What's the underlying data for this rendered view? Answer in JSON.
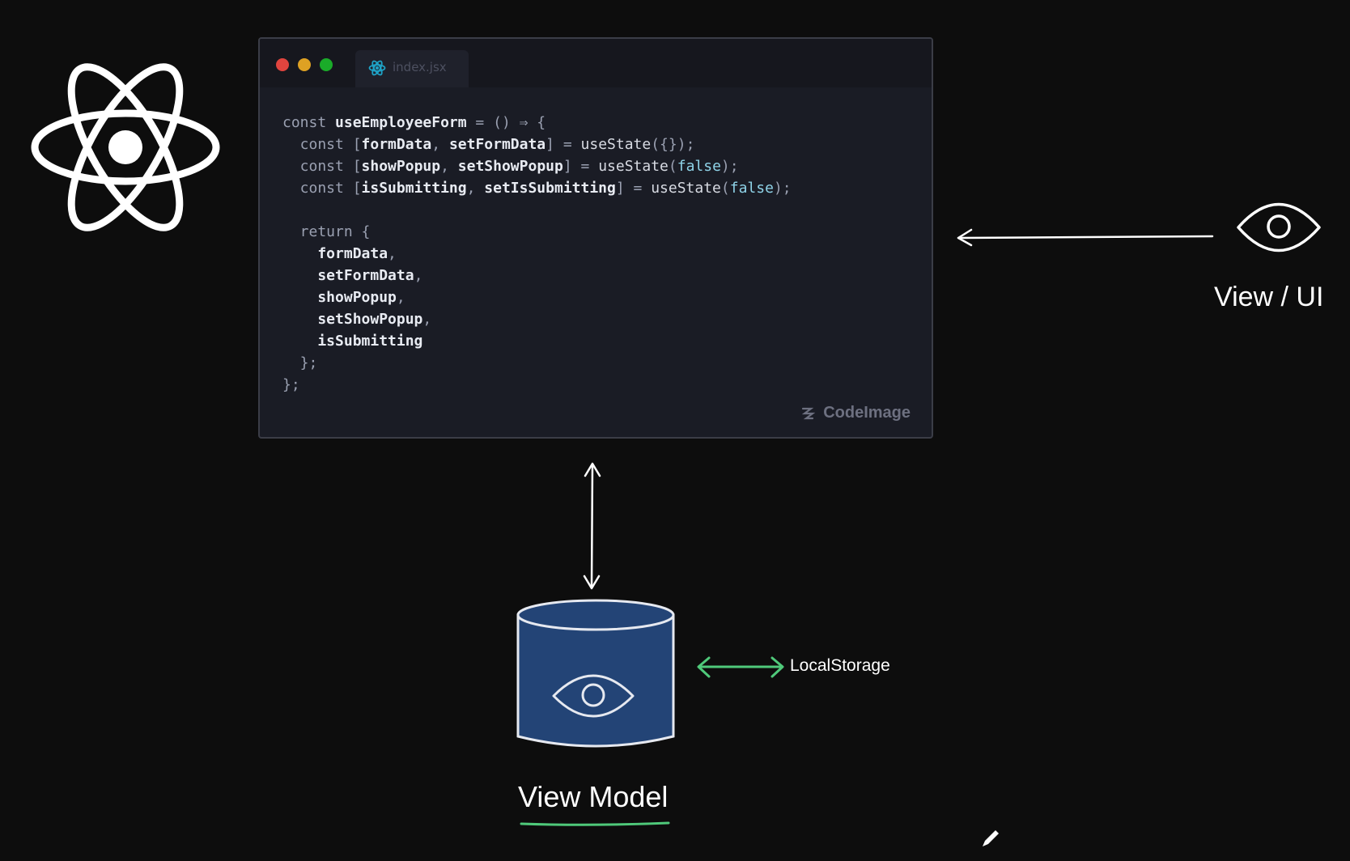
{
  "code_window": {
    "tab_label": "index.jsx",
    "watermark": "CodeImage",
    "dots": {
      "red": "#e0443e",
      "yellow": "#dea123",
      "green": "#1aab29"
    },
    "lines": [
      [
        [
          "kw",
          "const "
        ],
        [
          "id",
          "useEmployeeForm"
        ],
        [
          "pun",
          " = () ⇒ {"
        ]
      ],
      [
        [
          "kw",
          "  const "
        ],
        [
          "pun",
          "["
        ],
        [
          "id",
          "formData"
        ],
        [
          "pun",
          ", "
        ],
        [
          "id",
          "setFormData"
        ],
        [
          "pun",
          "] = "
        ],
        [
          "fn",
          "useState"
        ],
        [
          "pun",
          "({});"
        ]
      ],
      [
        [
          "kw",
          "  const "
        ],
        [
          "pun",
          "["
        ],
        [
          "id",
          "showPopup"
        ],
        [
          "pun",
          ", "
        ],
        [
          "id",
          "setShowPopup"
        ],
        [
          "pun",
          "] = "
        ],
        [
          "fn",
          "useState"
        ],
        [
          "pun",
          "("
        ],
        [
          "bool",
          "false"
        ],
        [
          "pun",
          ");"
        ]
      ],
      [
        [
          "kw",
          "  const "
        ],
        [
          "pun",
          "["
        ],
        [
          "id",
          "isSubmitting"
        ],
        [
          "pun",
          ", "
        ],
        [
          "id",
          "setIsSubmitting"
        ],
        [
          "pun",
          "] = "
        ],
        [
          "fn",
          "useState"
        ],
        [
          "pun",
          "("
        ],
        [
          "bool",
          "false"
        ],
        [
          "pun",
          ");"
        ]
      ],
      [],
      [
        [
          "kw",
          "  return "
        ],
        [
          "pun",
          "{"
        ]
      ],
      [
        [
          "id",
          "    formData"
        ],
        [
          "pun",
          ","
        ]
      ],
      [
        [
          "id",
          "    setFormData"
        ],
        [
          "pun",
          ","
        ]
      ],
      [
        [
          "id",
          "    showPopup"
        ],
        [
          "pun",
          ","
        ]
      ],
      [
        [
          "id",
          "    setShowPopup"
        ],
        [
          "pun",
          ","
        ]
      ],
      [
        [
          "id",
          "    isSubmitting"
        ]
      ],
      [
        [
          "pun",
          "  };"
        ]
      ],
      [
        [
          "pun",
          "};"
        ]
      ]
    ]
  },
  "labels": {
    "view_ui": "View / UI",
    "view_model": "View Model",
    "local_storage": "LocalStorage"
  },
  "icons": {
    "react": "react-logo-icon",
    "eye": "eye-icon",
    "database": "database-icon",
    "pencil": "pencil-icon"
  },
  "colors": {
    "background": "#0d0d0d",
    "db_fill": "#234476",
    "local_storage_arrow": "#4fc97a",
    "underline": "#4fc97a",
    "tab_icon": "#1fa3c7"
  }
}
